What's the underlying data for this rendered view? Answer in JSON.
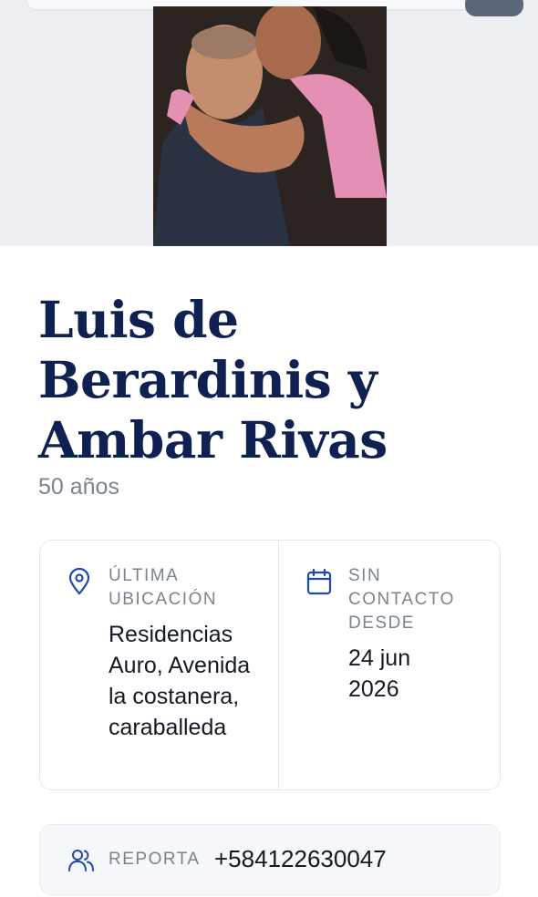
{
  "profile": {
    "name": "Luis de Berardinis y Ambar Rivas",
    "age": "50 años",
    "photo_alt": "Foto de Luis de Berardinis y Ambar Rivas"
  },
  "details": {
    "location_label_line1": "ÚLTIMA",
    "location_label_line2": "UBICACIÓN",
    "location_value": "Residencias Auro, Avenida la costanera, caraballeda",
    "contact_label_line1": "SIN",
    "contact_label_line2": "CONTACTO",
    "contact_label_line3": "DESDE",
    "contact_value": "24 jun 2026"
  },
  "report": {
    "label": "REPORTA",
    "phone": "+584122630047"
  },
  "icons": {
    "location": "map-pin-icon",
    "calendar": "calendar-icon",
    "users": "users-icon"
  },
  "colors": {
    "name": "#0f2150",
    "accent": "#1f4aa8",
    "muted": "#7b8390"
  }
}
